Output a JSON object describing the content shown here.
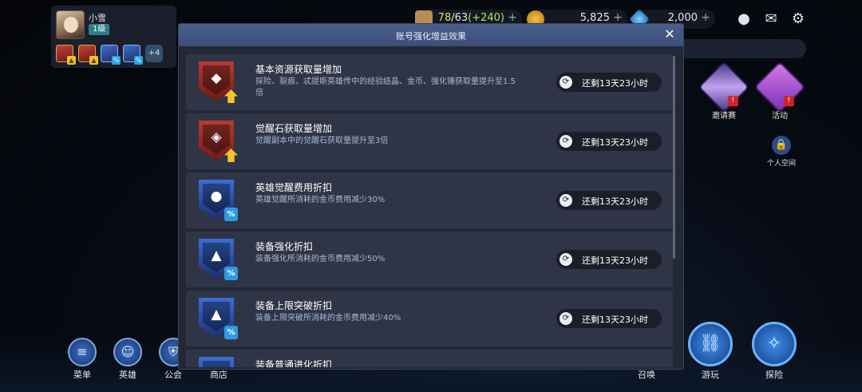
{
  "player": {
    "name": "小雪",
    "level": "1级",
    "buff_more": "+4"
  },
  "resources": {
    "stamina_current": "78",
    "stamina_rest": "/63",
    "stamina_extra": "(+240)",
    "gold": "5,825",
    "gems": "2,000",
    "plus": "+"
  },
  "side_events": {
    "invite_label": "邀请赛",
    "activity_label": "活动",
    "personal_label": "个人空间",
    "alert": "!"
  },
  "bottom_nav": {
    "menu": "菜单",
    "hero": "英雄",
    "guild": "公会",
    "shop": "商店",
    "summon": "召唤",
    "play": "游玩",
    "explore": "探险"
  },
  "modal": {
    "title": "账号强化增益效果",
    "close": "✕",
    "effects": [
      {
        "title": "基本资源获取量增加",
        "desc": "探险、裂痕、忒提斯英雄传中的经验结晶、金币、强化锤获取量提升至1.5倍",
        "timer": "还剩13天23小时",
        "badge": "red",
        "corner": "up",
        "glyph": "◆"
      },
      {
        "title": "觉醒石获取量增加",
        "desc": "觉醒副本中的觉醒石获取量提升至3倍",
        "timer": "还剩13天23小时",
        "badge": "red",
        "corner": "up",
        "glyph": "◈"
      },
      {
        "title": "英雄觉醒费用折扣",
        "desc": "英雄觉醒所消耗的金币费用减少30%",
        "timer": "还剩13天23小时",
        "badge": "blue",
        "corner": "pct",
        "glyph": "●"
      },
      {
        "title": "装备强化折扣",
        "desc": "装备强化所消耗的金币费用减少50%",
        "timer": "还剩13天23小时",
        "badge": "blue",
        "corner": "pct",
        "glyph": "▲"
      },
      {
        "title": "装备上限突破折扣",
        "desc": "装备上限突破所消耗的金币费用减少40%",
        "timer": "还剩13天23小时",
        "badge": "blue",
        "corner": "pct",
        "glyph": "▲"
      },
      {
        "title": "装备普通进化折扣",
        "desc": "",
        "timer": "",
        "badge": "blue",
        "corner": "pct",
        "glyph": "▲"
      }
    ]
  },
  "colors": {
    "modal_header": "#4a5f8d",
    "modal_bg": "#232836",
    "row_bg": "#2f3546",
    "desc_text": "#a9b8d6",
    "stamina_value": "#f0d46a",
    "stamina_extra": "#a9e76b"
  },
  "icons": {
    "chat": "chat-icon",
    "mail": "mail-icon",
    "settings": "gear-icon",
    "clock": "clock-icon",
    "close": "close-icon"
  }
}
